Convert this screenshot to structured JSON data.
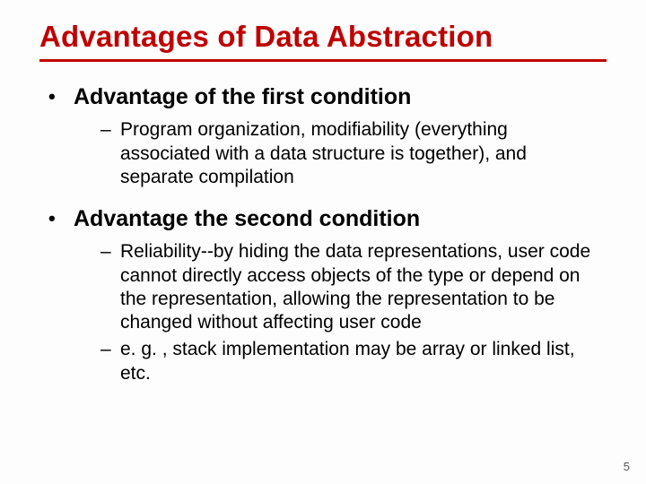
{
  "slide": {
    "title": "Advantages of Data Abstraction",
    "bullets": [
      {
        "text": "Advantage of the first condition",
        "sub": [
          "Program organization, modifiability (everything associated with a data structure is together), and separate compilation"
        ]
      },
      {
        "text": "Advantage the second condition",
        "sub": [
          "Reliability--by hiding the data representations, user code cannot directly access objects of the type or depend on the representation, allowing the representation to be changed without affecting user code",
          "e. g. , stack implementation may be array or linked list, etc."
        ]
      }
    ],
    "page_number": "5"
  }
}
